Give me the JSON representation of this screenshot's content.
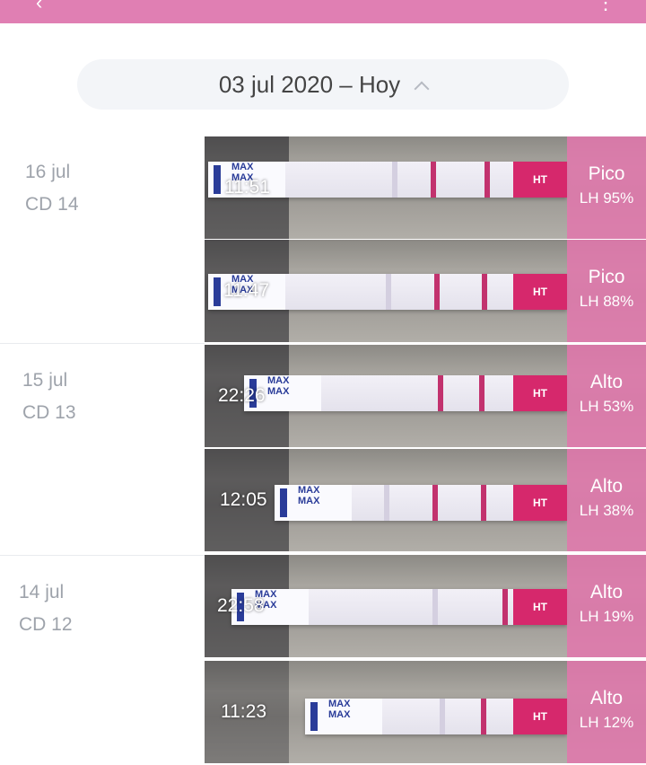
{
  "header": {
    "back_icon": "chevron-left-icon",
    "menu_icon": "more-icon",
    "color": "#e07fb3"
  },
  "date_range": {
    "label": "03 jul 2020 – Hoy",
    "icon": "chevron-up-icon"
  },
  "days": [
    {
      "date": "16 jul",
      "cycle_day": "CD 14"
    },
    {
      "date": "15 jul",
      "cycle_day": "CD 13"
    },
    {
      "date": "14 jul",
      "cycle_day": "CD 12"
    }
  ],
  "tests": [
    {
      "time": "11:51",
      "level": "Pico",
      "lh": "LH 95%",
      "strip_brand": "HT"
    },
    {
      "time": "11:47",
      "level": "Pico",
      "lh": "LH 88%",
      "strip_brand": "HT"
    },
    {
      "time": "22:26",
      "level": "Alto",
      "lh": "LH 53%",
      "strip_brand": "HT"
    },
    {
      "time": "12:05",
      "level": "Alto",
      "lh": "LH 38%",
      "strip_brand": "HT"
    },
    {
      "time": "22:58",
      "level": "Alto",
      "lh": "LH 19%",
      "strip_brand": "HT"
    },
    {
      "time": "11:23",
      "level": "Alto",
      "lh": "LH 12%",
      "strip_brand": "HT"
    }
  ],
  "strip_text": "MAX",
  "colors": {
    "result_bg": "#e078ac",
    "test_line": "#c2326e",
    "strip_end": "#d6286c",
    "max_blue": "#2a3c99"
  }
}
